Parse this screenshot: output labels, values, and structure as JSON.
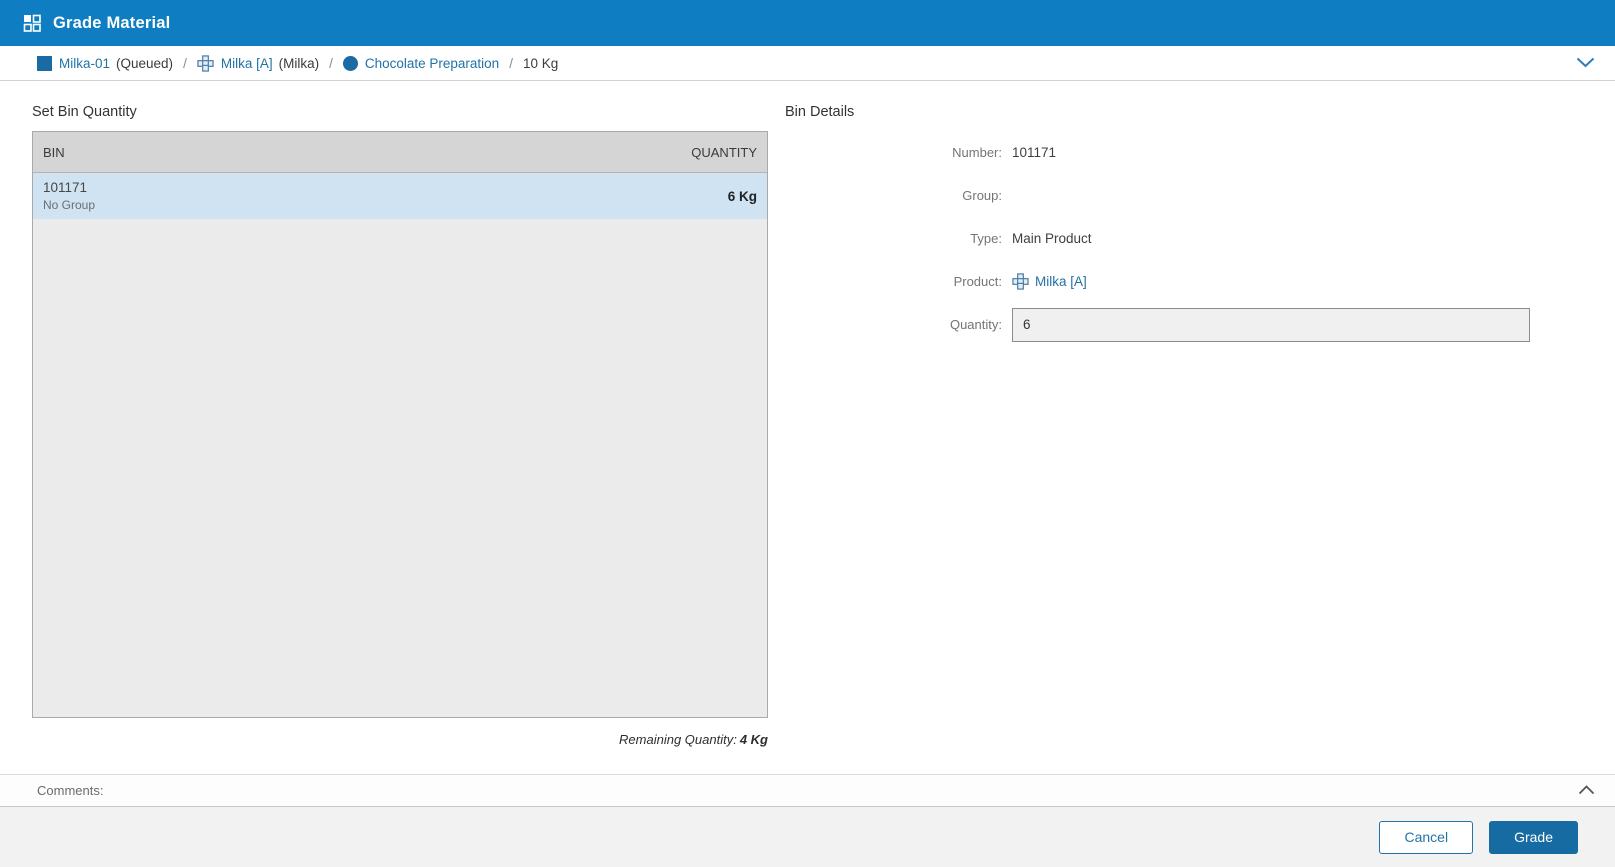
{
  "header": {
    "title": "Grade Material"
  },
  "breadcrumb": {
    "separator": "/",
    "items": [
      {
        "icon": "square-icon",
        "label": "Milka-01",
        "suffix": "(Queued)"
      },
      {
        "icon": "product-icon",
        "label": "Milka [A]",
        "suffix": "(Milka)"
      },
      {
        "icon": "circle-icon",
        "label": "Chocolate Preparation",
        "suffix": ""
      },
      {
        "icon": "",
        "label": "10 Kg",
        "suffix": ""
      }
    ]
  },
  "left_panel": {
    "title": "Set Bin Quantity",
    "table": {
      "columns": [
        "BIN",
        "QUANTITY"
      ],
      "rows": [
        {
          "bin": "101171",
          "group": "No Group",
          "quantity": "6 Kg"
        }
      ]
    },
    "remaining_label": "Remaining Quantity:",
    "remaining_value": "4 Kg"
  },
  "right_panel": {
    "title": "Bin Details",
    "fields": [
      {
        "label": "Number:",
        "value": "101171"
      },
      {
        "label": "Group:",
        "value": ""
      },
      {
        "label": "Type:",
        "value": "Main Product"
      },
      {
        "label": "Product:",
        "value": "Milka [A]"
      },
      {
        "label": "Quantity:",
        "value": "6"
      }
    ]
  },
  "comments": {
    "label": "Comments:"
  },
  "footer": {
    "cancel_label": "Cancel",
    "grade_label": "Grade"
  },
  "colors": {
    "header_blue": "#0e7dc2",
    "button_blue": "#176ba3",
    "link_blue": "#2273a6",
    "selected_row": "#cfe3f2",
    "table_header": "#d5d5d5"
  }
}
